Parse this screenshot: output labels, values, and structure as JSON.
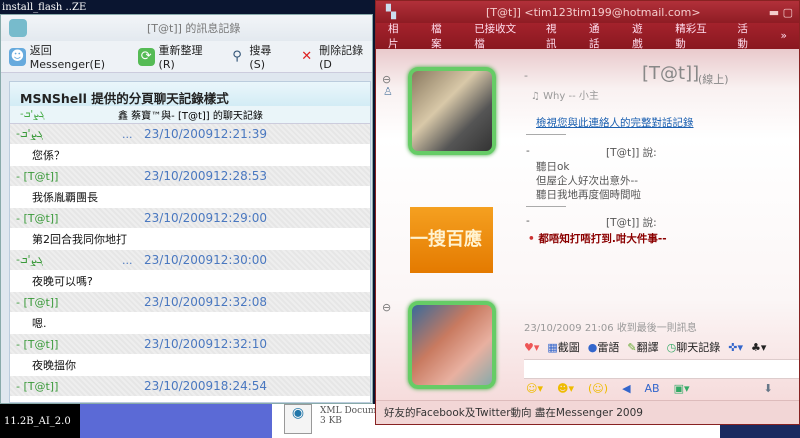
{
  "desktop": {
    "icon1": "install_flash ...",
    "icon2": "ZE",
    "icon3": "11.2B_AI_2.0",
    "file_type": "XML Document",
    "file_size": "3 KB"
  },
  "history_window": {
    "title": "[T@t]] 的訊息記錄",
    "toolbar": [
      {
        "label": "返回 Messenger(E)",
        "icon": "users-icon"
      },
      {
        "label": "重新整理(R)",
        "icon": "refresh-icon"
      },
      {
        "label": "搜尋(S)",
        "icon": "search-icon"
      },
      {
        "label": "刪除記錄(D",
        "icon": "delete-icon"
      }
    ],
    "heading": "MSNShell 提供的分頁聊天記錄樣式",
    "sub_left": "-ܓܨ'ܒ",
    "sub_title": "鑫 蔡寶™與- [T@t]] 的聊天記錄",
    "messages": [
      {
        "name": "-ܓܨ'ܒ",
        "dots": "...",
        "time": "23/10/200912:21:39",
        "text": "您係？"
      },
      {
        "name": "- [T@t]]",
        "dots": "",
        "time": "23/10/200912:28:53",
        "text": "我係胤覇團長"
      },
      {
        "name": "- [T@t]]",
        "dots": "",
        "time": "23/10/200912:29:00",
        "text": "第2回合我同你地打"
      },
      {
        "name": "-ܓܨ'ܒ",
        "dots": "...",
        "time": "23/10/200912:30:00",
        "text": "夜晚可以嗎?"
      },
      {
        "name": "- [T@t]]",
        "dots": "",
        "time": "23/10/200912:32:08",
        "text": "嗯."
      },
      {
        "name": "- [T@t]]",
        "dots": "",
        "time": "23/10/200912:32:10",
        "text": "夜晚搵你"
      },
      {
        "name": "- [T@t]]",
        "dots": "",
        "time": "23/10/200918:24:54",
        "text": ""
      }
    ]
  },
  "chat_window": {
    "title": "[T@t]] <tim123tim199@hotmail.com>",
    "menu": [
      "相片",
      "檔案",
      "已接收文檔",
      "視訊",
      "通話",
      "遊戲",
      "精彩互動",
      "活動",
      "»"
    ],
    "contact_name": "[T@t]]",
    "contact_status": "(線上)",
    "dash": "-",
    "personal_message": "Why -- 小主",
    "history_link": "檢視您與此連絡人的完整對話記錄",
    "msg1_header": "[T@t]] 說:",
    "msg1_lines": [
      "聽日ok",
      "但屋企人好次出意外--",
      "聽日我地再度個時間啦"
    ],
    "msg2_header": "[T@t]] 說:",
    "msg2_line": "都唔知打唔打到.咁大件事--",
    "ad_text": "一搜百應",
    "last_received": "23/10/2009 21:06 收到最後一則訊息",
    "toolbar": [
      "截圖",
      "雷語",
      "翻譯",
      "聊天記錄"
    ],
    "status_bar": "好友的Facebook及Twitter動向  盡在Messenger 2009",
    "colors": {
      "title": "#9e2029",
      "name_green": "#3a9a3a",
      "time_blue": "#4a78c0",
      "red_text": "#8b0000"
    }
  }
}
